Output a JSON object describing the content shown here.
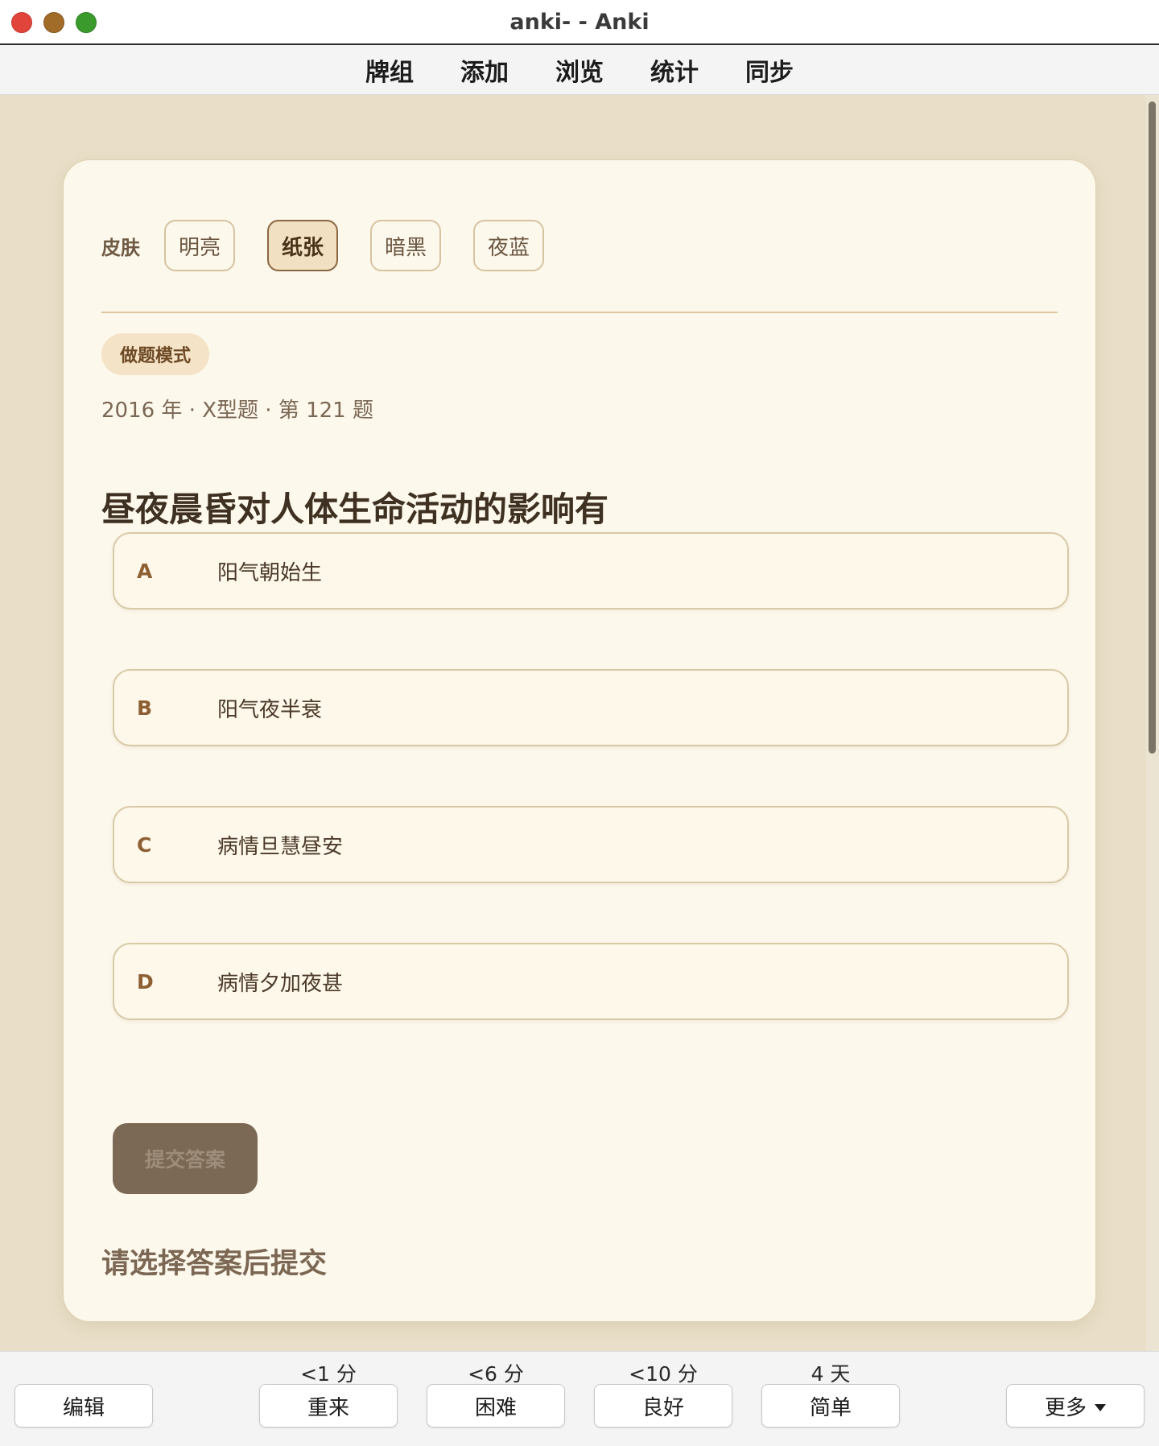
{
  "window": {
    "title": "anki- - Anki"
  },
  "menu": [
    "牌组",
    "添加",
    "浏览",
    "统计",
    "同步"
  ],
  "card": {
    "skin_label": "皮肤",
    "skins": [
      {
        "label": "明亮",
        "active": false
      },
      {
        "label": "纸张",
        "active": true
      },
      {
        "label": "暗黑",
        "active": false
      },
      {
        "label": "夜蓝",
        "active": false
      }
    ],
    "mode": "做题模式",
    "meta": "2016 年 · X型题 · 第 121 题",
    "question": "昼夜晨昏对人体生命活动的影响有",
    "options": [
      {
        "letter": "A",
        "text": "阳气朝始生"
      },
      {
        "letter": "B",
        "text": "阳气夜半衰"
      },
      {
        "letter": "C",
        "text": "病情旦慧昼安"
      },
      {
        "letter": "D",
        "text": "病情夕加夜甚"
      }
    ],
    "submit_label": "提交答案",
    "hint": "请选择答案后提交"
  },
  "bottom": {
    "edit_label": "编辑",
    "answers": [
      {
        "interval": "<1 分",
        "label": "重来"
      },
      {
        "interval": "<6 分",
        "label": "困难"
      },
      {
        "interval": "<10 分",
        "label": "良好"
      },
      {
        "interval": "4 天",
        "label": "简单"
      }
    ],
    "more_label": "更多"
  }
}
